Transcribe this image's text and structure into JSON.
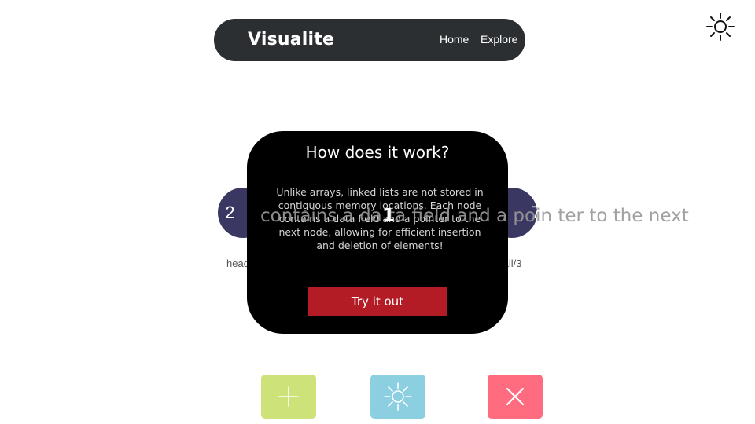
{
  "navbar": {
    "brand": "Visualite",
    "links": [
      "Home",
      "Explore"
    ]
  },
  "theme_toggle": {
    "icon": "sun-icon"
  },
  "linked_list": {
    "head_value": "2",
    "tail_value": "7",
    "head_label": "head/0",
    "tail_label": "tail/3",
    "overlay_value": "1",
    "node_color": "#3a3762"
  },
  "background_text": "contains a da ta field and a poin  ter to the next",
  "modal": {
    "title": "How does it work?",
    "body": "Unlike arrays, linked lists are not stored in contiguous memory locations. Each node contains a data field and a pointer to the next node, allowing for efficient insertion and deletion of elements!",
    "button_label": "Try it out",
    "button_color": "#b31c25"
  },
  "actions": [
    {
      "icon": "plus-icon",
      "color": "#cde37a"
    },
    {
      "icon": "sun-icon",
      "color": "#8ccfe0"
    },
    {
      "icon": "close-icon",
      "color": "#ff6b7f"
    }
  ]
}
